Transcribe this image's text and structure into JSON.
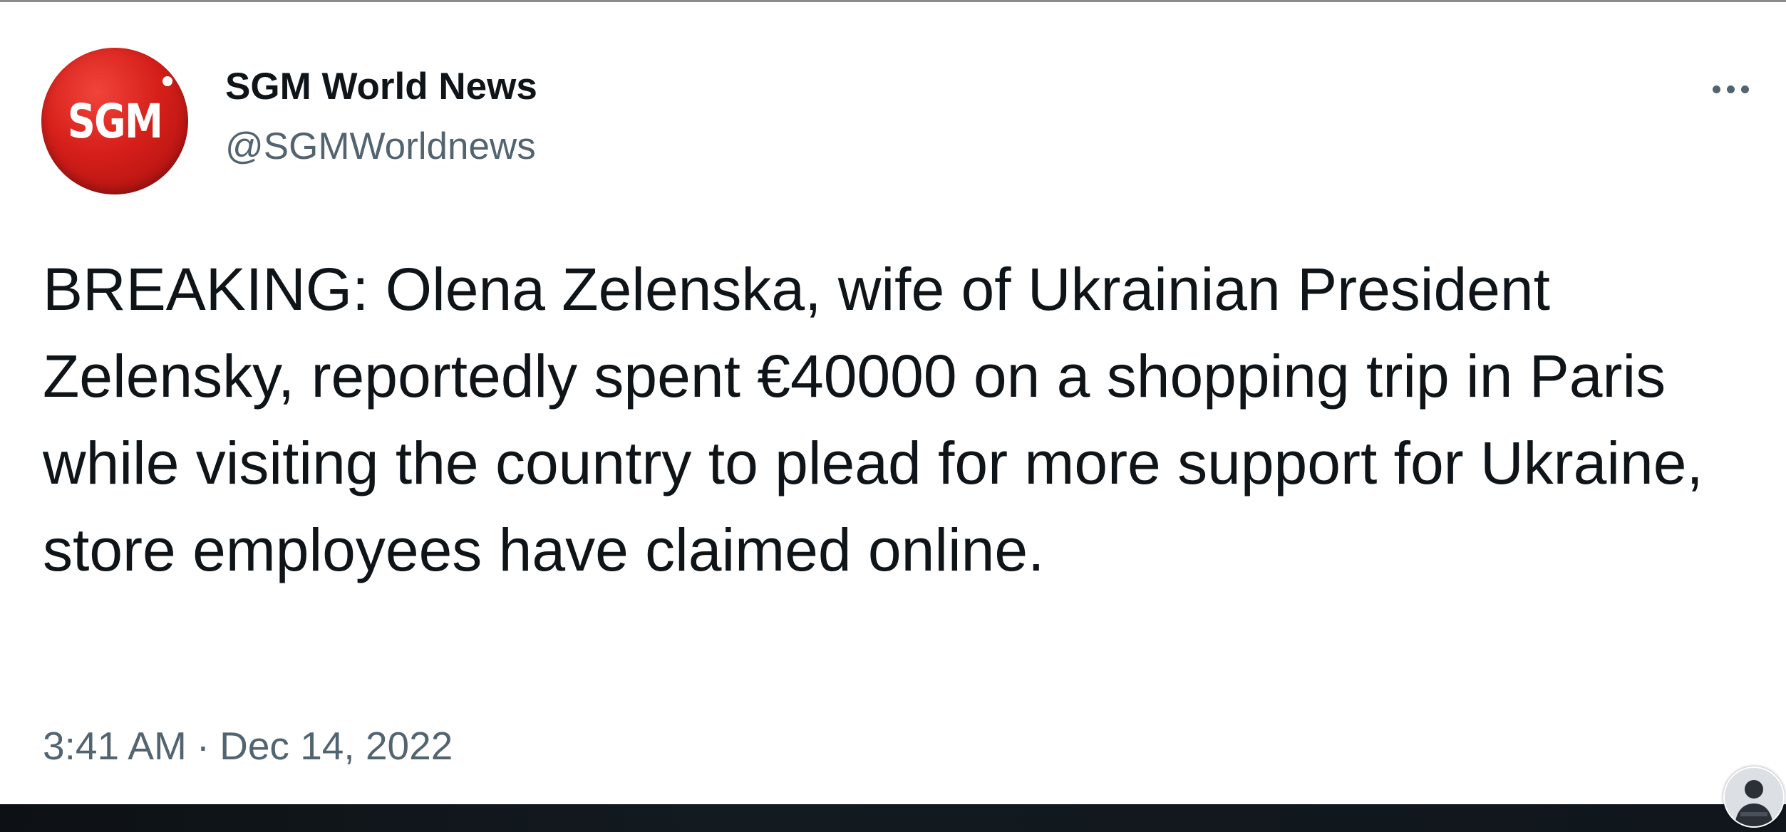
{
  "tweet": {
    "author": {
      "avatar_text": "SGM",
      "display_name": "SGM World News",
      "handle": "@SGMWorldnews"
    },
    "text": "BREAKING: Olena Zelenska, wife of Ukrainian President Zelensky, reportedly spent €40000 on a shopping trip in Paris while visiting the country to plead for more support for Ukraine, store employees have claimed online.",
    "time": "3:41 AM",
    "separator": "·",
    "date": "Dec 14, 2022"
  },
  "icons": {
    "more": "more-horizontal-icon",
    "creator_avatar": "person-avatar-icon"
  },
  "colors": {
    "avatar_red": "#d61f1a",
    "text_primary": "#0f1419",
    "text_secondary": "#536471",
    "bottom_bar": "#10161b"
  }
}
